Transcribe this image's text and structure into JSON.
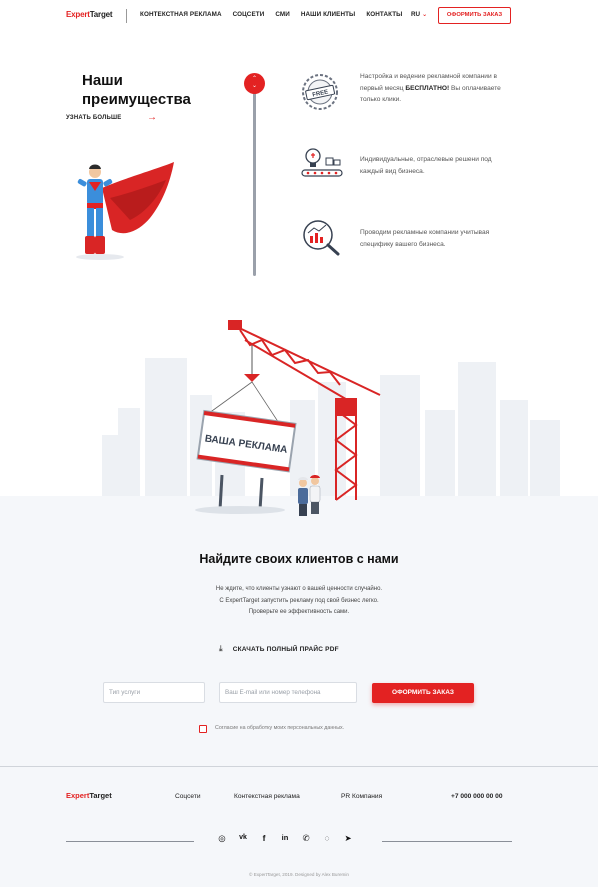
{
  "header": {
    "logo_red": "Expert",
    "logo_dark": "Target",
    "nav": [
      "КОНТЕКСТНАЯ РЕКЛАМА",
      "СОЦСЕТИ",
      "СМИ",
      "НАШИ КЛИЕНТЫ",
      "КОНТАКТЫ"
    ],
    "lang": "RU",
    "cta": "ОФОРМИТЬ ЗАКАЗ"
  },
  "advantages": {
    "title_line1": "Наши",
    "title_line2": "преимущества",
    "more": "УЗНАТЬ БОЛЬШЕ",
    "items": [
      {
        "icon": "free-badge-icon",
        "text_before": "Настройка и ведение рекламной компании в первый месяц ",
        "text_bold": "БЕСПЛАТНО!",
        "text_after": " Вы оплачиваете только клики."
      },
      {
        "icon": "lightbulb-conveyor-icon",
        "text": "Индивидуальные, отраслевые решени под каждый вид бизнеса."
      },
      {
        "icon": "analytics-magnifier-icon",
        "text": "Проводим рекламные компании учитывая специфику вашего бизнеса."
      }
    ]
  },
  "billboard_text": "ВАША РЕКЛАМА",
  "find": {
    "title": "Найдите своих клиентов с нами",
    "lines": [
      "Не ждите, что клиенты узнают о вашей ценности случайно.",
      "С ExpertTarget запустить рекламу под свой бизнес легко.",
      "Проверьте ее эффективность сами."
    ],
    "pdf": "СКАЧАТЬ ПОЛНЫЙ ПРАЙС PDF",
    "service_placeholder": "Тип услуги",
    "contact_placeholder": "Ваш E-mail или номер телефона",
    "order": "ОФОРМИТЬ ЗАКАЗ",
    "consent": "Согласие на обработку моих персональных данных."
  },
  "footer": {
    "logo_red": "Expert",
    "logo_dark": "Target",
    "nav": [
      "Соцсети",
      "Контекстная реклама",
      "PR Компания"
    ],
    "phone": "+7 000 000 00 00",
    "socials": [
      "instagram-icon",
      "vk-icon",
      "facebook-icon",
      "linkedin-icon",
      "viber-icon",
      "whatsapp-icon",
      "telegram-icon"
    ],
    "copyright": "© ExpertTarget, 2019. Designed by Alex Buremin"
  },
  "colors": {
    "accent": "#e32222",
    "bg_light": "#f5f7fa"
  }
}
